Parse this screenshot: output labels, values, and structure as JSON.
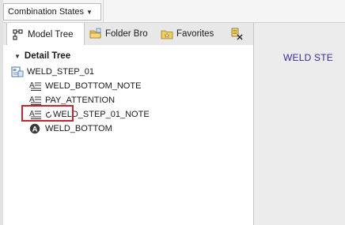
{
  "toolbar": {
    "combination_states_label": "Combination States",
    "dropdown_icon": "chevron-down-icon"
  },
  "tabs": [
    {
      "label": "Model Tree",
      "icon": "model-tree-icon",
      "active": true
    },
    {
      "label": "Folder Bro",
      "icon": "folder-browser-icon",
      "active": false
    },
    {
      "label": "Favorites",
      "icon": "favorites-icon",
      "active": false
    },
    {
      "label": "",
      "icon": "layer-tree-icon",
      "active": false
    }
  ],
  "tree": {
    "header": "Detail Tree",
    "root": {
      "label": "WELD_STEP_01",
      "icon": "drawing-icon"
    },
    "items": [
      {
        "label": "WELD_BOTTOM_NOTE",
        "icon": "note-icon"
      },
      {
        "label": "PAY_ATTENTION",
        "icon": "note-icon"
      },
      {
        "label": "WELD_STEP_01_NOTE",
        "icon": "note-icon",
        "highlighted": true
      },
      {
        "label": "WELD_BOTTOM",
        "icon": "symbol-icon"
      }
    ]
  },
  "graphics": {
    "visible_text": "WELD STE"
  },
  "colors": {
    "graphics_text": "#3a2a96",
    "highlight_box": "#c0282d",
    "graphics_bg": "#ececec"
  }
}
